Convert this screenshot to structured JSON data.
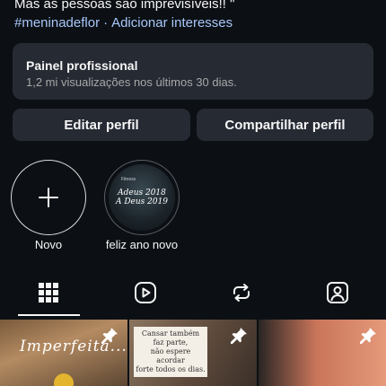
{
  "bio": {
    "line1": "Mas as pessoas são imprevisíveis!! \"",
    "hashtag": "#meninadeflor",
    "separator": "·",
    "interests": "Adicionar interesses"
  },
  "panel": {
    "title": "Painel profissional",
    "subtitle": "1,2 mi visualizações nos últimos 30 dias."
  },
  "buttons": {
    "edit": "Editar perfil",
    "share": "Compartilhar perfil"
  },
  "highlights": [
    {
      "label": "Novo",
      "icon": "plus-icon"
    },
    {
      "label": "feliz ano novo",
      "cover_small": "Fitness",
      "cover_line1": "Adeus 2018",
      "cover_line2": "A Deus 2019"
    }
  ],
  "tabs": [
    {
      "icon": "grid-icon",
      "selected": true
    },
    {
      "icon": "reels-icon",
      "selected": false
    },
    {
      "icon": "reposts-icon",
      "selected": false
    },
    {
      "icon": "tagged-icon",
      "selected": false
    }
  ],
  "posts": [
    {
      "text": "Imperfeita...",
      "pinned": true
    },
    {
      "note_lines": [
        "Cansar também",
        "faz parte,",
        "não espere acordar",
        "forte todos os dias."
      ],
      "pinned": true
    },
    {
      "pinned": true
    }
  ],
  "colors": {
    "background": "#0c1014",
    "card": "#262a33",
    "link": "#a8c7fa"
  }
}
